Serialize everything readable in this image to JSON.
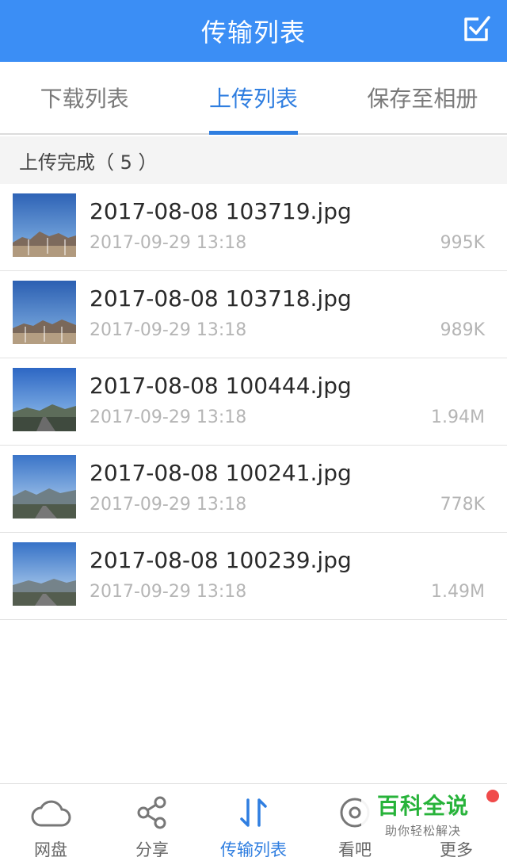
{
  "header": {
    "title": "传输列表",
    "edit_icon": "checkbox-edit-icon"
  },
  "tabs": [
    {
      "label": "下载列表",
      "active": false
    },
    {
      "label": "上传列表",
      "active": true
    },
    {
      "label": "保存至相册",
      "active": false
    }
  ],
  "section": {
    "title": "上传完成（ 5 ）"
  },
  "files": [
    {
      "name": "2017-08-08 103719.jpg",
      "date": "2017-09-29 13:18",
      "size": "995K"
    },
    {
      "name": "2017-08-08 103718.jpg",
      "date": "2017-09-29 13:18",
      "size": "989K"
    },
    {
      "name": "2017-08-08 100444.jpg",
      "date": "2017-09-29 13:18",
      "size": "1.94M"
    },
    {
      "name": "2017-08-08 100241.jpg",
      "date": "2017-09-29 13:18",
      "size": "778K"
    },
    {
      "name": "2017-08-08 100239.jpg",
      "date": "2017-09-29 13:18",
      "size": "1.49M"
    }
  ],
  "bottom_nav": [
    {
      "label": "网盘",
      "icon": "cloud-icon",
      "active": false
    },
    {
      "label": "分享",
      "icon": "share-icon",
      "active": false
    },
    {
      "label": "传输列表",
      "icon": "transfer-icon",
      "active": true
    },
    {
      "label": "看吧",
      "icon": "eye-icon",
      "active": false
    },
    {
      "label": "更多",
      "icon": "more-icon",
      "active": false
    }
  ],
  "watermark": {
    "title": "百科全说",
    "subtitle": "助你轻松解决"
  },
  "colors": {
    "primary": "#3b8ef5",
    "active": "#2f7ee0",
    "watermark": "#27b33a"
  }
}
